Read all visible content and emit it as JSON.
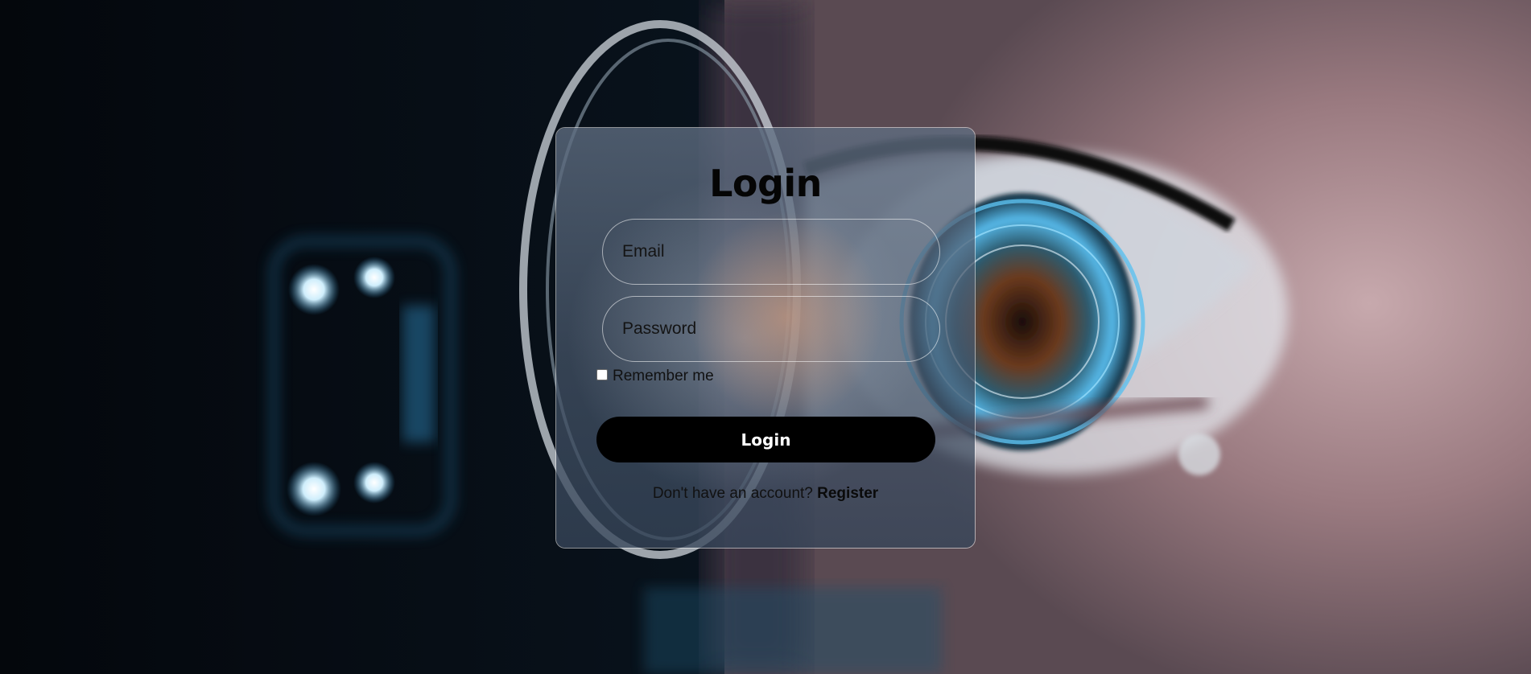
{
  "page": {
    "background_image": "cyber-eye-scan"
  },
  "form": {
    "title": "Login",
    "email_placeholder": "Email",
    "password_placeholder": "Password",
    "remember_label": "Remember me",
    "remember_checked": false,
    "submit_label": "Login",
    "register_prompt": "Don't have an account?",
    "register_link": "Register"
  },
  "colors": {
    "button_bg": "#000000",
    "button_text": "#ffffff",
    "card_border": "#ffffff"
  }
}
